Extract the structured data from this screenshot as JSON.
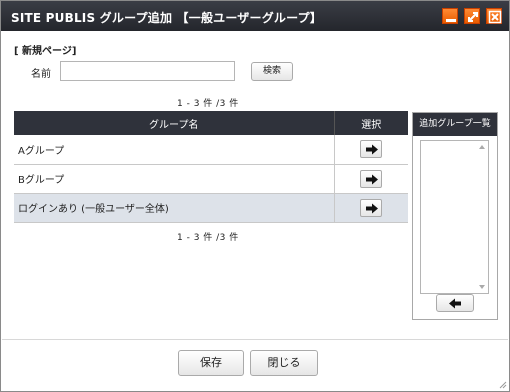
{
  "window": {
    "title": "SITE PUBLIS グループ追加 【一般ユーザーグループ】"
  },
  "form": {
    "section_title": "[ 新規ページ]",
    "name_label": "名前",
    "name_value": "",
    "search_label": "検索"
  },
  "results": {
    "count_top": "1 - 3 件 /3 件",
    "count_bottom": "1 - 3 件 /3 件",
    "columns": {
      "name": "グループ名",
      "select": "選択"
    },
    "rows": [
      {
        "name": "Aグループ"
      },
      {
        "name": "Bグループ"
      },
      {
        "name": "ログインあり (一般ユーザー全体)"
      }
    ]
  },
  "added_panel": {
    "header": "追加グループ一覧",
    "items": []
  },
  "footer": {
    "save_label": "保存",
    "close_label": "閉じる"
  },
  "colors": {
    "titlebar": "#2a2c32",
    "window_button": "#f06a10",
    "table_header": "#2f323b",
    "highlight_row": "#dde2e9"
  },
  "icons": {
    "minimize": "minimize-icon",
    "maximize": "maximize-icon",
    "close": "close-icon",
    "add": "arrow-right-icon",
    "remove": "arrow-left-icon"
  }
}
